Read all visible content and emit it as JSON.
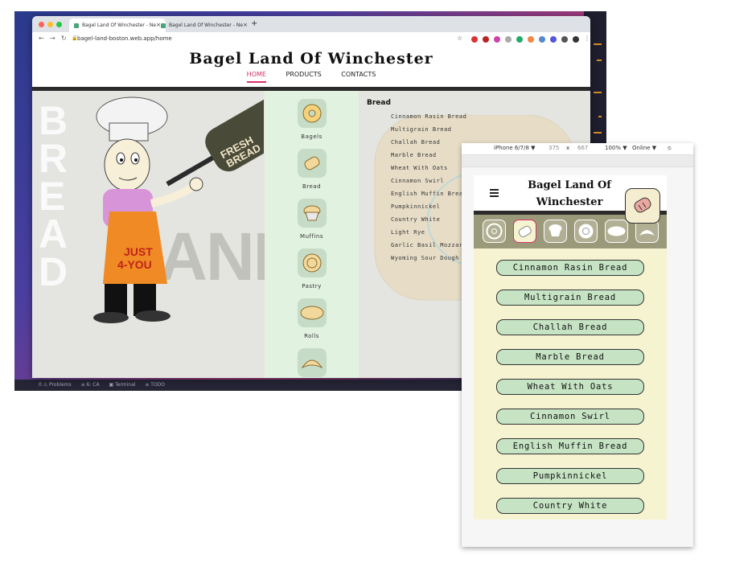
{
  "browser": {
    "tabs": [
      {
        "label": "Bagel Land Of Winchester - Ne",
        "close": "×"
      },
      {
        "label": "Bagel Land Of Winchester - Ne",
        "close": "×"
      }
    ],
    "new_tab": "+",
    "url": "bagel-land-boston.web.app/home"
  },
  "site": {
    "title": "Bagel Land Of Winchester",
    "nav": [
      "HOME",
      "PRODUCTS",
      "CONTACTS"
    ],
    "active_nav": "HOME"
  },
  "hero": {
    "bg_word_vertical": "BREAD",
    "bg_word": "LAND",
    "sign": "FRESH BREAD",
    "apron": "JUST 4-YOU"
  },
  "categories": [
    {
      "label": "Bagels",
      "icon": "bagel-icon"
    },
    {
      "label": "Bread",
      "icon": "bread-icon"
    },
    {
      "label": "Muffins",
      "icon": "muffin-icon"
    },
    {
      "label": "Pastry",
      "icon": "pastry-icon"
    },
    {
      "label": "Rolls",
      "icon": "roll-icon"
    },
    {
      "label": "",
      "icon": "croissant-icon"
    }
  ],
  "bread": {
    "title": "Bread",
    "items": [
      "Cinnamon Rasin Bread",
      "Multigrain Bread",
      "Challah Bread",
      "Marble Bread",
      "Wheat With Oats",
      "Cinnamon Swirl",
      "English Muffin Bread",
      "Pumpkinnickel",
      "Country White",
      "Light Rye",
      "Garlic Basil Mozzare",
      "Wyoming Sour Dough"
    ]
  },
  "devtools": {
    "device": "iPhone 6/7/8 ▼",
    "width": "375",
    "times": "x",
    "height": "667",
    "zoom": "100% ▼",
    "network": "Online ▼"
  },
  "mobile": {
    "title": "Bagel Land Of Winchester",
    "buttons": [
      "Cinnamon Rasin Bread",
      "Multigrain Bread",
      "Challah Bread",
      "Marble Bread",
      "Wheat With Oats",
      "Cinnamon Swirl",
      "English Muffin Bread",
      "Pumpkinnickel",
      "Country White"
    ]
  },
  "statusbar": [
    "0 ⚠ Problems",
    "≡ 6: CA",
    "▣ Terminal",
    "≡ TODO"
  ],
  "colors": {
    "accent": "#d5336a",
    "cat_panel": "#e2f2e0",
    "pill": "#c6e4c4",
    "mobile_bg": "#f6f3d0",
    "icon_band": "#9a9a7a"
  }
}
